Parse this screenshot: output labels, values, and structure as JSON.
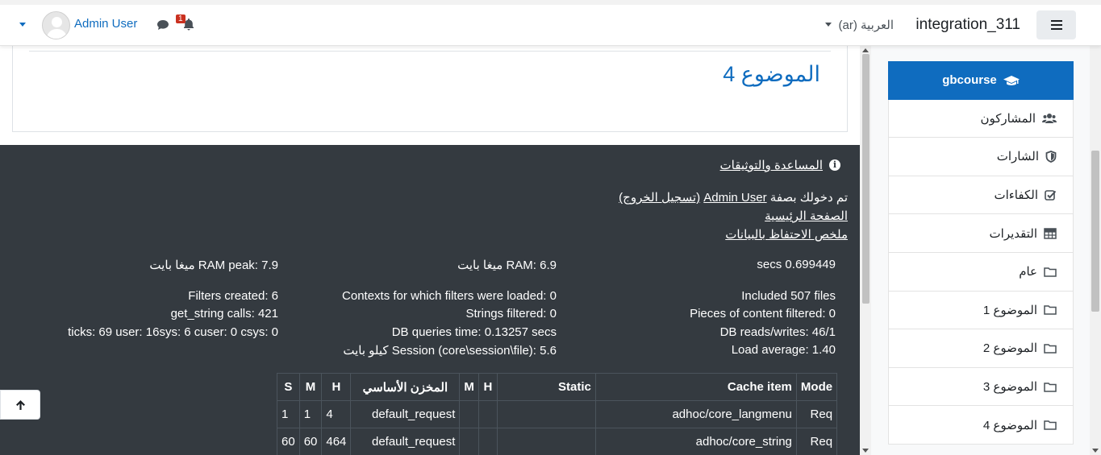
{
  "navbar": {
    "site_name": "integration_311",
    "language": "العربية (ar)",
    "user_name": "Admin User",
    "notification_count": "1"
  },
  "section": {
    "title": "الموضوع 4"
  },
  "footer": {
    "help_link": "المساعدة والتوثيقات",
    "logged_in_prefix": "تم دخولك بصفة",
    "logged_in_user": "Admin User",
    "logout": "(تسجيل الخروج)",
    "home": "الصفحة الرئيسية",
    "data_retention": "ملخص الاحتفاظ بالبيانات",
    "perf": {
      "secs": "secs 0.699449",
      "ram": "RAM: 6.9 ميغا بايت",
      "ram_peak": "RAM peak: 7.9 ميغا بايت",
      "included": "Included 507 files",
      "contexts": "Contexts for which filters were loaded: 0",
      "filters_created": "Filters created: 6",
      "pieces": "Pieces of content filtered: 0",
      "strings_filtered": "Strings filtered: 0",
      "get_string": "get_string calls: 421",
      "db_rw": "DB reads/writes: 46/1",
      "db_time": "DB queries time: 0.13257 secs",
      "ticks": "ticks: 69 user: 16sys: 6 cuser: 0 csys: 0",
      "load": "Load average: 1.40",
      "session": "Session (core\\session\\file): 5.6 كيلو بايت"
    },
    "cache_table": {
      "headers": [
        "Mode",
        "Cache item",
        "Static",
        "H",
        "M",
        "المخزن الأساسي",
        "H",
        "M",
        "S"
      ],
      "rows": [
        [
          "Req",
          "adhoc/core_langmenu",
          "",
          "",
          "",
          "default_request",
          "4",
          "1",
          "1"
        ],
        [
          "Req",
          "adhoc/core_string",
          "",
          "",
          "",
          "default_request",
          "464",
          "60",
          "60"
        ]
      ]
    }
  },
  "drawer": {
    "items": [
      {
        "label": "gbcourse",
        "icon": "graduation-cap-icon"
      },
      {
        "label": "المشاركون",
        "icon": "users-icon"
      },
      {
        "label": "الشارات",
        "icon": "shield-icon"
      },
      {
        "label": "الكفاءات",
        "icon": "check-square-icon"
      },
      {
        "label": "التقديرات",
        "icon": "table-icon"
      },
      {
        "label": "عام",
        "icon": "folder-icon"
      },
      {
        "label": "الموضوع 1",
        "icon": "folder-icon"
      },
      {
        "label": "الموضوع 2",
        "icon": "folder-icon"
      },
      {
        "label": "الموضوع 3",
        "icon": "folder-icon"
      },
      {
        "label": "الموضوع 4",
        "icon": "folder-icon"
      }
    ]
  },
  "colors": {
    "primary": "#0f6cbf",
    "footer_bg": "#343a40",
    "badge": "#ca3120"
  }
}
